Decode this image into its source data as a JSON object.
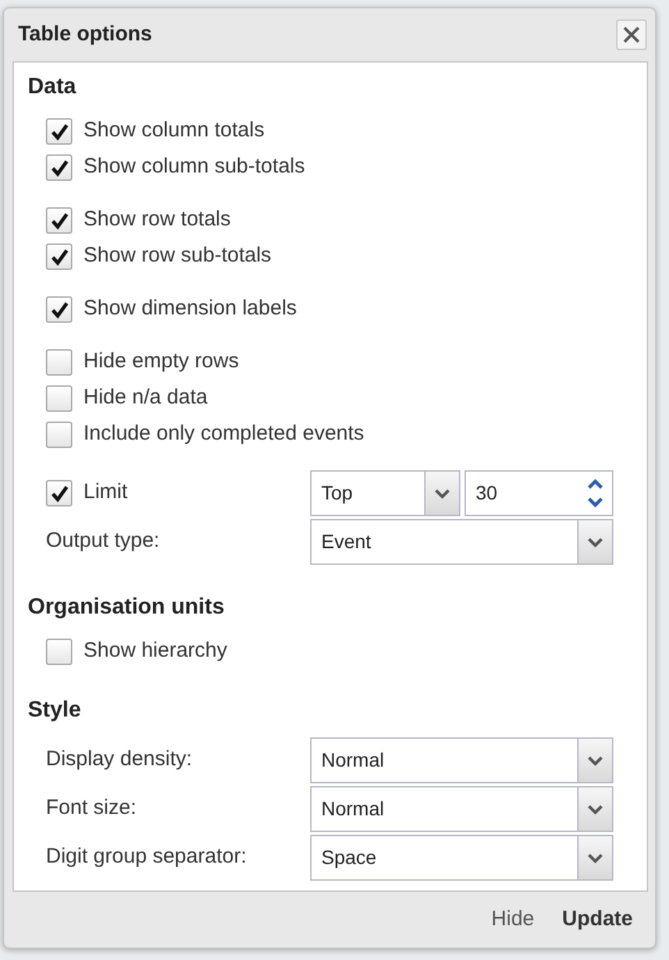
{
  "window": {
    "title": "Table options"
  },
  "sections": [
    {
      "heading": "Data",
      "groups": [
        [
          {
            "kind": "checkbox",
            "label": "Show column totals",
            "checked": true
          },
          {
            "kind": "checkbox",
            "label": "Show column sub-totals",
            "checked": true
          }
        ],
        [
          {
            "kind": "checkbox",
            "label": "Show row totals",
            "checked": true
          },
          {
            "kind": "checkbox",
            "label": "Show row sub-totals",
            "checked": true
          }
        ],
        [
          {
            "kind": "checkbox",
            "label": "Show dimension labels",
            "checked": true
          }
        ],
        [
          {
            "kind": "checkbox",
            "label": "Hide empty rows",
            "checked": false
          },
          {
            "kind": "checkbox",
            "label": "Hide n/a data",
            "checked": false
          },
          {
            "kind": "checkbox",
            "label": "Include only completed events",
            "checked": false
          }
        ],
        [
          {
            "kind": "limit",
            "label": "Limit",
            "checked": true,
            "select": "Top",
            "number": "30"
          },
          {
            "kind": "select",
            "label": "Output type:",
            "value": "Event"
          }
        ]
      ]
    },
    {
      "heading": "Organisation units",
      "groups": [
        [
          {
            "kind": "checkbox",
            "label": "Show hierarchy",
            "checked": false
          }
        ]
      ]
    },
    {
      "heading": "Style",
      "groups": [
        [
          {
            "kind": "select",
            "label": "Display density:",
            "value": "Normal"
          },
          {
            "kind": "select",
            "label": "Font size:",
            "value": "Normal"
          },
          {
            "kind": "select",
            "label": "Digit group separator:",
            "value": "Space"
          }
        ]
      ]
    }
  ],
  "footer": {
    "buttons": [
      {
        "label": "Hide",
        "primary": false
      },
      {
        "label": "Update",
        "primary": true
      }
    ]
  }
}
